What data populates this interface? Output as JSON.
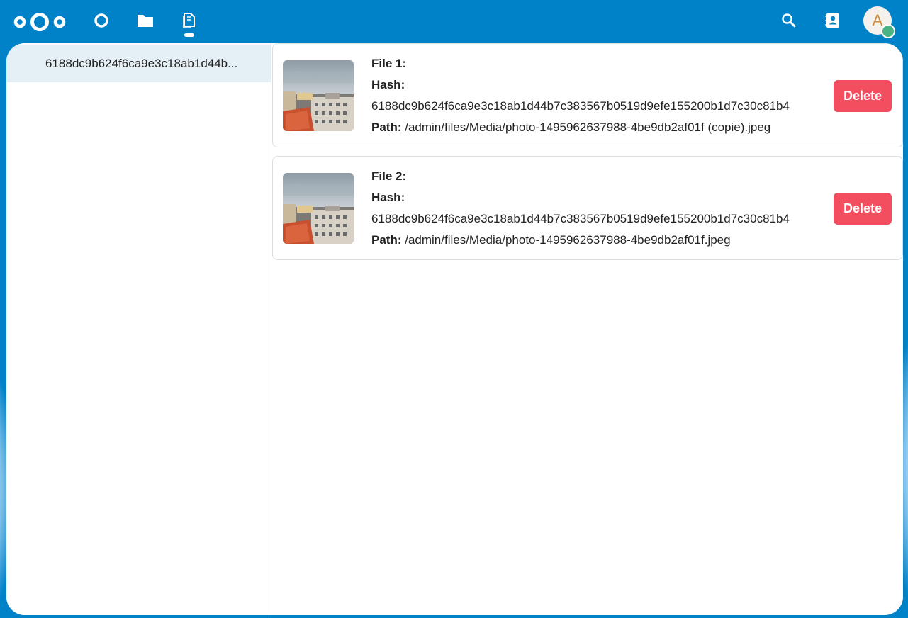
{
  "header": {
    "logo_icon": "nextcloud-logo-icon",
    "nav": [
      {
        "icon": "dashboard-icon"
      },
      {
        "icon": "folder-icon"
      },
      {
        "icon": "duplicate-files-icon"
      }
    ],
    "search_icon": "search-icon",
    "contacts_icon": "contacts-icon",
    "avatar_initial": "A",
    "status_color": "#49b382",
    "brand_color": "#0082c9"
  },
  "sidebar": {
    "items": [
      {
        "label": "6188dc9b624f6ca9e3c18ab1d44b..."
      }
    ]
  },
  "files": [
    {
      "title": "File 1:",
      "hash_label": "Hash:",
      "hash": "6188dc9b624f6ca9e3c18ab1d44b7c383567b0519d9efe155200b1d7c30c81b4",
      "path_label": "Path:",
      "path": " /admin/files/Media/photo-1495962637988-4be9db2af01f (copie).jpeg",
      "delete_label": "Delete"
    },
    {
      "title": "File 2:",
      "hash_label": "Hash:",
      "hash": "6188dc9b624f6ca9e3c18ab1d44b7c383567b0519d9efe155200b1d7c30c81b4",
      "path_label": "Path:",
      "path": " /admin/files/Media/photo-1495962637988-4be9db2af01f.jpeg",
      "delete_label": "Delete"
    }
  ],
  "colors": {
    "delete": "#f34e5f",
    "selected_item": "#e5eff6"
  }
}
